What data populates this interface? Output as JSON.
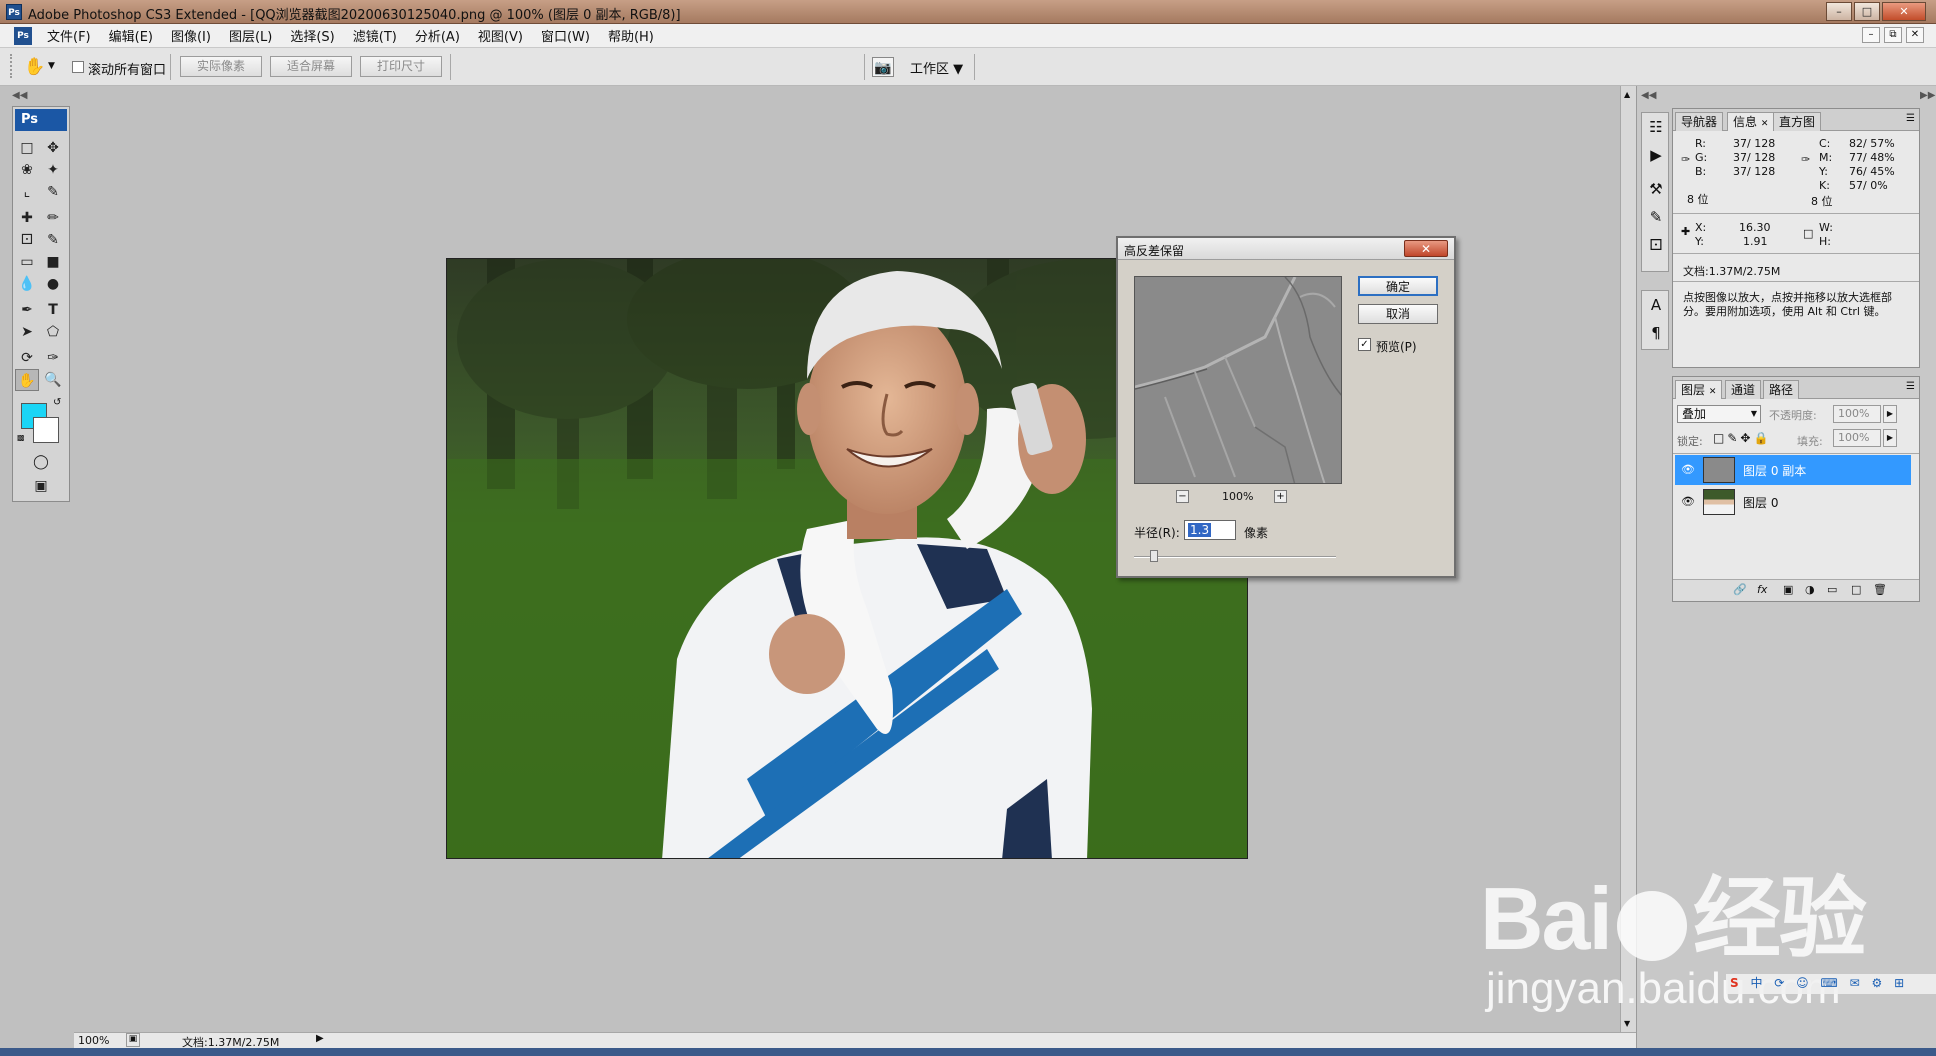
{
  "window": {
    "title": "Adobe Photoshop CS3 Extended - [QQ浏览器截图20200630125040.png @ 100% (图层 0 副本, RGB/8)]",
    "app_icon": "Ps"
  },
  "menu": {
    "items": [
      "文件(F)",
      "编辑(E)",
      "图像(I)",
      "图层(L)",
      "选择(S)",
      "滤镜(T)",
      "分析(A)",
      "视图(V)",
      "窗口(W)",
      "帮助(H)"
    ]
  },
  "options_bar": {
    "scroll_all_windows": "滚动所有窗口",
    "actual_pixels": "实际像素",
    "fit_screen": "适合屏幕",
    "print_size": "打印尺寸",
    "workspace": "工作区"
  },
  "toolbox": {
    "header": "Ps",
    "foreground_color": "#1ad5f6",
    "background_color": "#ffffff"
  },
  "dialog": {
    "title": "高反差保留",
    "ok": "确定",
    "cancel": "取消",
    "preview_label": "预览(P)",
    "preview_checked": true,
    "zoom": "100%",
    "radius_label": "半径(R):",
    "radius_value": "1.3",
    "radius_unit": "像素"
  },
  "info_panel": {
    "tabs": [
      "导航器",
      "信息",
      "直方图"
    ],
    "rgb": [
      {
        "label": "R:",
        "value": "37/  128"
      },
      {
        "label": "G:",
        "value": "37/  128"
      },
      {
        "label": "B:",
        "value": "37/  128"
      }
    ],
    "cmyk": [
      {
        "label": "C:",
        "value": "82/  57%"
      },
      {
        "label": "M:",
        "value": "77/  48%"
      },
      {
        "label": "Y:",
        "value": "76/  45%"
      },
      {
        "label": "K:",
        "value": "57/   0%"
      }
    ],
    "bit_depth_left": "8 位",
    "bit_depth_right": "8 位",
    "x_label": "X:",
    "x_value": "16.30",
    "y_label": "Y:",
    "y_value": "1.91",
    "w_label": "W:",
    "h_label": "H:",
    "doc": "文档:1.37M/2.75M",
    "hint": "点按图像以放大，点按并拖移以放大选框部分。要用附加选项，使用 Alt 和 Ctrl 键。"
  },
  "layers_panel": {
    "tabs": [
      "图层",
      "通道",
      "路径"
    ],
    "blend_mode": "叠加",
    "opacity_label": "不透明度:",
    "opacity": "100%",
    "lock_label": "锁定:",
    "fill_label": "填充:",
    "fill": "100%",
    "layers": [
      {
        "name": "图层 0 副本",
        "selected": true
      },
      {
        "name": "图层 0",
        "selected": false
      }
    ]
  },
  "status": {
    "zoom": "100%",
    "doc": "文档:1.37M/2.75M"
  },
  "watermark": {
    "brand": "Bai",
    "brand2": "经验",
    "url": "jingyan.baidu.com"
  }
}
